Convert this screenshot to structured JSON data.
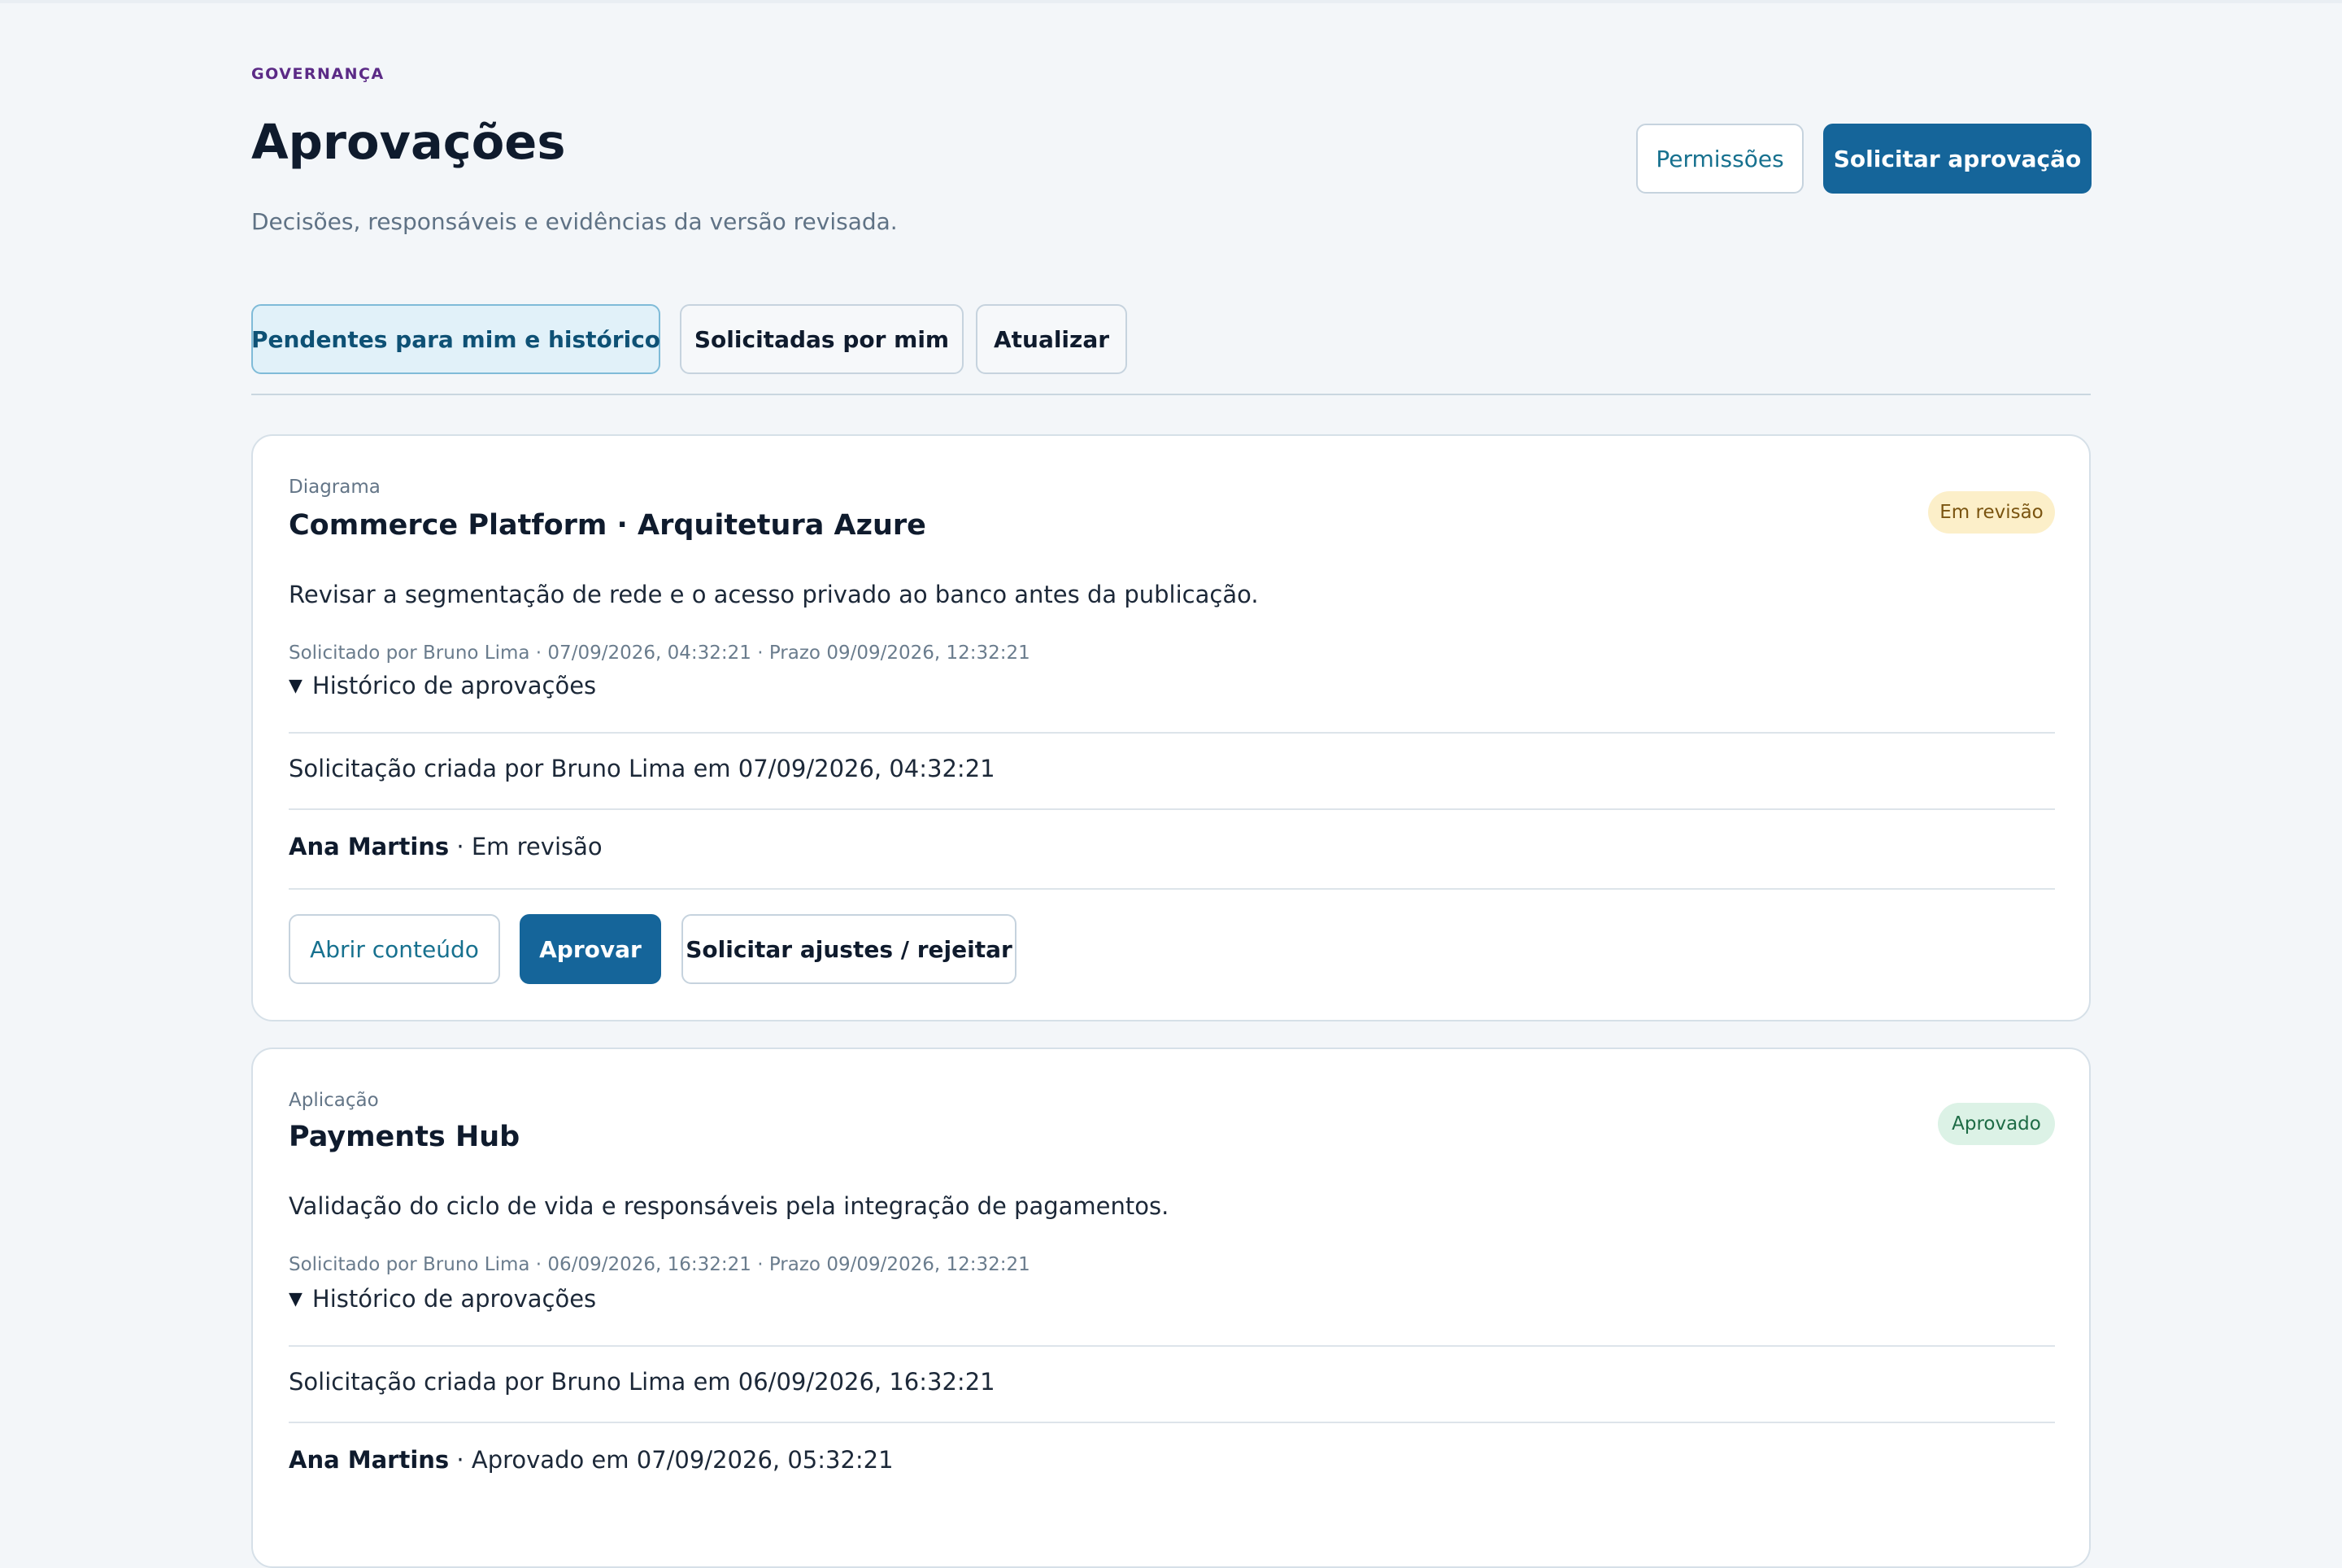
{
  "header": {
    "eyebrow": "GOVERNANÇA",
    "title": "Aprovações",
    "subtitle": "Decisões, responsáveis e evidências da versão revisada.",
    "permissions_label": "Permissões",
    "request_label": "Solicitar aprovação"
  },
  "tabs": [
    {
      "label": "Pendentes para mim e histórico",
      "active": true
    },
    {
      "label": "Solicitadas por mim",
      "active": false
    },
    {
      "label": "Atualizar",
      "active": false
    }
  ],
  "cards": [
    {
      "kind": "Diagrama",
      "title": "Commerce Platform · Arquitetura Azure",
      "status": "Em revisão",
      "description": "Revisar a segmentação de rede e o acesso privado ao banco antes da publicação.",
      "meta": "Solicitado por Bruno Lima · 07/09/2026, 04:32:21 · Prazo 09/09/2026, 12:32:21",
      "history_label": "Histórico de aprovações",
      "history_created": "Solicitação criada por Bruno Lima em 07/09/2026, 04:32:21",
      "reviewer_name": "Ana Martins",
      "reviewer_status": " · Em revisão",
      "actions": {
        "open": "Abrir conteúdo",
        "approve": "Aprovar",
        "reject": "Solicitar ajustes / rejeitar"
      }
    },
    {
      "kind": "Aplicação",
      "title": "Payments Hub",
      "status": "Aprovado",
      "description": "Validação do ciclo de vida e responsáveis pela integração de pagamentos.",
      "meta": "Solicitado por Bruno Lima · 06/09/2026, 16:32:21 · Prazo 09/09/2026, 12:32:21",
      "history_label": "Histórico de aprovações",
      "history_created": "Solicitação criada por Bruno Lima em 06/09/2026, 16:32:21",
      "reviewer_name": "Ana Martins",
      "reviewer_status": " · Aprovado em 07/09/2026, 05:32:21"
    }
  ],
  "colors": {
    "background": "#f3f6f9",
    "primary": "#15659a",
    "eyebrow": "#5b2a86",
    "badge_review_bg": "#fcefc9",
    "badge_approved_bg": "#dcf2e6"
  },
  "icons": {
    "history_toggle": "triangle-down-icon"
  }
}
